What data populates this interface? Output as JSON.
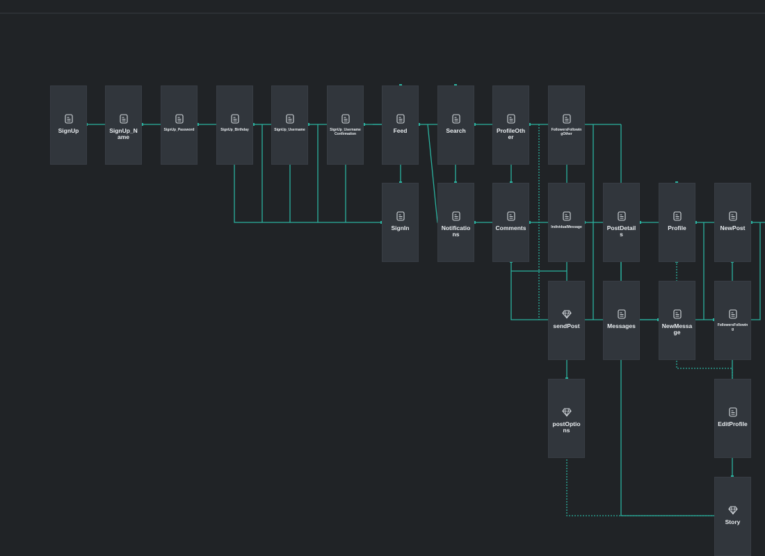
{
  "colors": {
    "background": "#202326",
    "node": "#31363c",
    "connector": "#2bb3a0",
    "icon": "#d7dce0",
    "label": "#e9edf0"
  },
  "screens": [
    {
      "id": "signup",
      "label": "SignUp",
      "icon": "page-icon",
      "small": false
    },
    {
      "id": "signup-name",
      "label": "SignUp_Name",
      "icon": "page-icon",
      "small": false
    },
    {
      "id": "signup-password",
      "label": "SignUp_Password",
      "icon": "page-icon",
      "small": true
    },
    {
      "id": "signup-birthday",
      "label": "SignUp_Birthday",
      "icon": "page-icon",
      "small": true
    },
    {
      "id": "signup-username",
      "label": "SignUp_Username",
      "icon": "page-icon",
      "small": true
    },
    {
      "id": "signup-username-confirmation",
      "label": "SignUp_UsernameConfirmation",
      "icon": "page-icon",
      "small": true
    },
    {
      "id": "feed",
      "label": "Feed",
      "icon": "page-icon",
      "small": false
    },
    {
      "id": "search",
      "label": "Search",
      "icon": "page-icon",
      "small": false
    },
    {
      "id": "profile-other",
      "label": "ProfileOther",
      "icon": "page-icon",
      "small": false
    },
    {
      "id": "followers-following-other",
      "label": "FollowersFollowingOther",
      "icon": "page-icon",
      "small": true
    },
    {
      "id": "signin",
      "label": "SignIn",
      "icon": "page-icon",
      "small": false
    },
    {
      "id": "notifications",
      "label": "Notifications",
      "icon": "page-icon",
      "small": false
    },
    {
      "id": "comments",
      "label": "Comments",
      "icon": "page-icon",
      "small": false
    },
    {
      "id": "individual-message",
      "label": "IndividualMessage",
      "icon": "page-icon",
      "small": true
    },
    {
      "id": "post-details",
      "label": "PostDetails",
      "icon": "page-icon",
      "small": false
    },
    {
      "id": "profile",
      "label": "Profile",
      "icon": "page-icon",
      "small": false
    },
    {
      "id": "new-post",
      "label": "NewPost",
      "icon": "page-icon",
      "small": false
    },
    {
      "id": "send-post",
      "label": "sendPost",
      "icon": "diamond-icon",
      "small": false
    },
    {
      "id": "messages",
      "label": "Messages",
      "icon": "page-icon",
      "small": false
    },
    {
      "id": "new-message",
      "label": "NewMessage",
      "icon": "page-icon",
      "small": false
    },
    {
      "id": "followers-following",
      "label": "FollowersFollowing",
      "icon": "page-icon",
      "small": true
    },
    {
      "id": "post-options",
      "label": "postOptions",
      "icon": "diamond-icon",
      "small": false
    },
    {
      "id": "edit-profile",
      "label": "EditProfile",
      "icon": "page-icon",
      "small": false
    },
    {
      "id": "story",
      "label": "Story",
      "icon": "diamond-icon",
      "small": false
    }
  ]
}
